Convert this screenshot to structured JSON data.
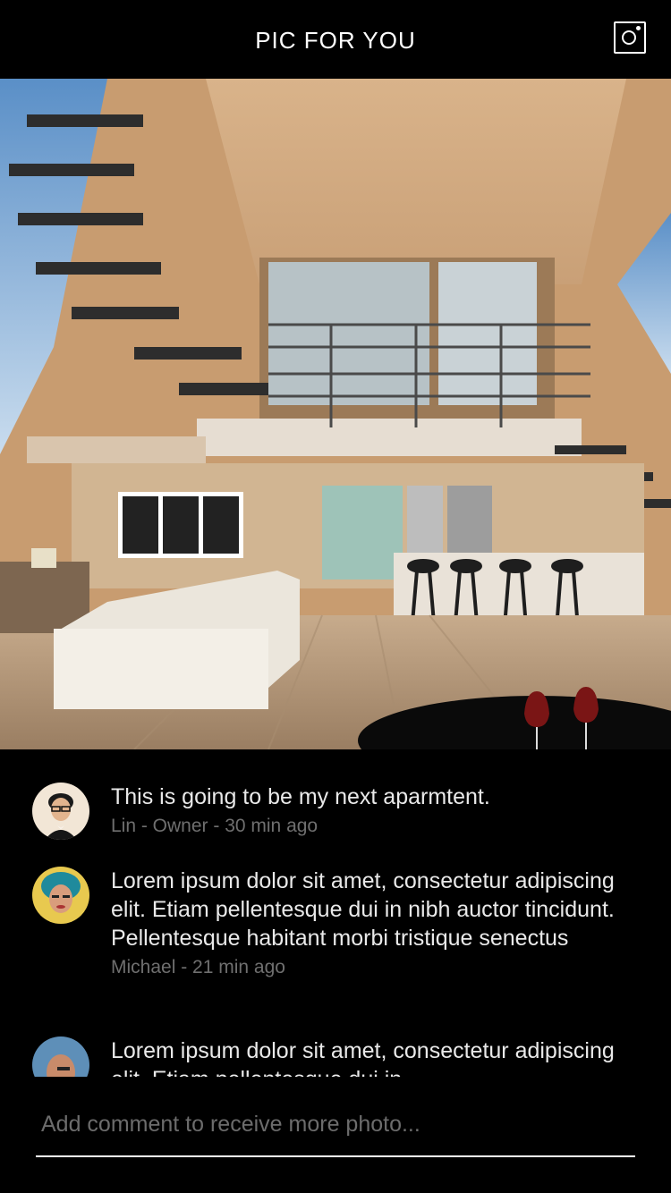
{
  "header": {
    "title": "PIC FOR YOU",
    "camera_icon": "camera-icon"
  },
  "photo": {
    "subject": "interior-photo"
  },
  "comments": [
    {
      "text": "This is going to be my next aparmtent.",
      "meta": "Lin - Owner - 30 min ago",
      "avatar": "avatar-lin"
    },
    {
      "text": "Lorem ipsum dolor sit amet, consectetur adipiscing elit. Etiam pellentesque dui in nibh auctor tincidunt. Pellentesque habitant morbi tristique senectus",
      "meta": "Michael -  21 min ago",
      "avatar": "avatar-michael"
    },
    {
      "text": "Lorem ipsum dolor sit amet, consectetur adipiscing elit. Etiam pellentesque dui in",
      "meta": "",
      "avatar": "avatar-third"
    }
  ],
  "composer": {
    "placeholder": "Add comment to receive more photo..."
  },
  "colors": {
    "background": "#000000",
    "text": "#e9e9e9",
    "meta": "#6f6f6f"
  }
}
